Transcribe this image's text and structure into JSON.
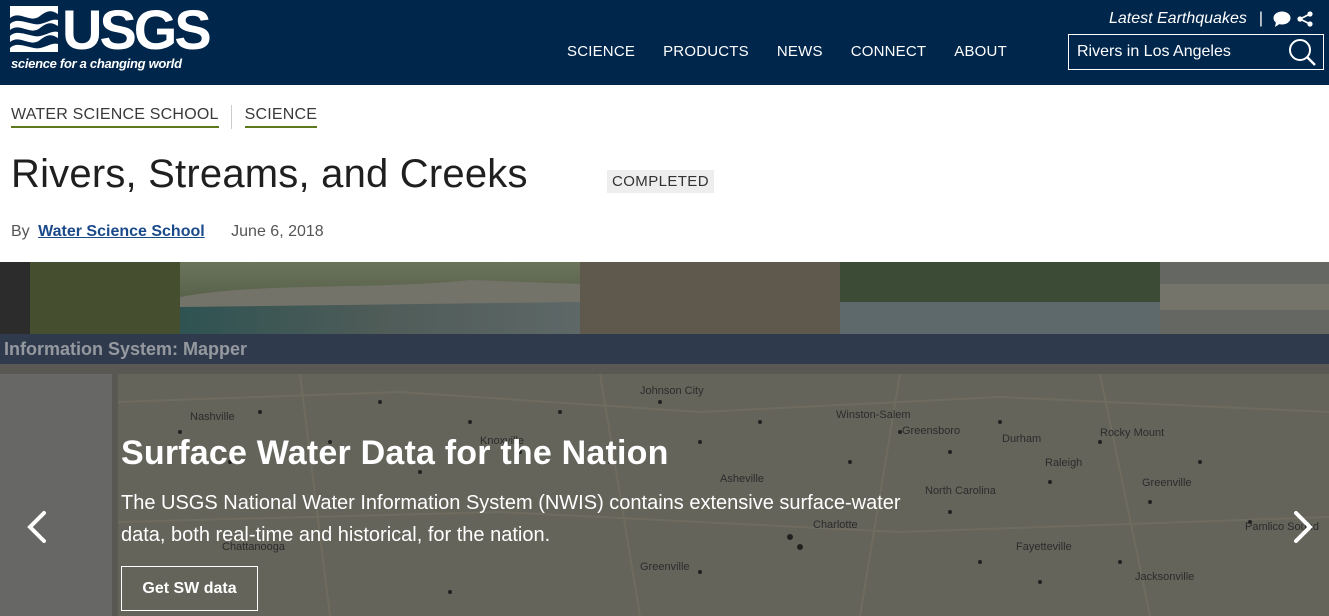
{
  "brand": {
    "name": "USGS",
    "tagline": "science for a changing world"
  },
  "utility": {
    "earthquakes": "Latest Earthquakes",
    "divider": "|",
    "icons": [
      "chat-icon",
      "share-icon"
    ]
  },
  "nav": [
    {
      "label": "SCIENCE"
    },
    {
      "label": "PRODUCTS"
    },
    {
      "label": "NEWS"
    },
    {
      "label": "CONNECT"
    },
    {
      "label": "ABOUT"
    }
  ],
  "search": {
    "value": "Rivers in Los Angeles",
    "icon": "search-icon"
  },
  "breadcrumb": [
    {
      "label": "WATER SCIENCE SCHOOL"
    },
    {
      "label": "SCIENCE"
    }
  ],
  "page": {
    "title": "Rivers, Streams, and Creeks",
    "status": "COMPLETED",
    "by_prefix": "By",
    "author": "Water Science School",
    "date": "June 6, 2018"
  },
  "hero": {
    "heading": "Surface Water Data for the Nation",
    "body": "The USGS National Water Information System (NWIS) contains extensive surface-water data, both real-time and historical, for the nation.",
    "button": "Get SW data",
    "bg_text": {
      "mapper_bar": "Information System: Mapper",
      "places": [
        "Johnson City",
        "Nashville",
        "Knoxville",
        "Winston-Salem",
        "Greensboro",
        "Durham",
        "Rocky Mount",
        "Raleigh",
        "Asheville",
        "North Carolina",
        "Greenville",
        "Charlotte",
        "Chattanooga",
        "Fayetteville",
        "Pamlico Sound",
        "Jacksonville",
        "Greenville"
      ]
    }
  },
  "colors": {
    "header_bg": "#00264c",
    "breadcrumb_underline": "#5c7a1c",
    "author_link": "#1b4a8a"
  }
}
